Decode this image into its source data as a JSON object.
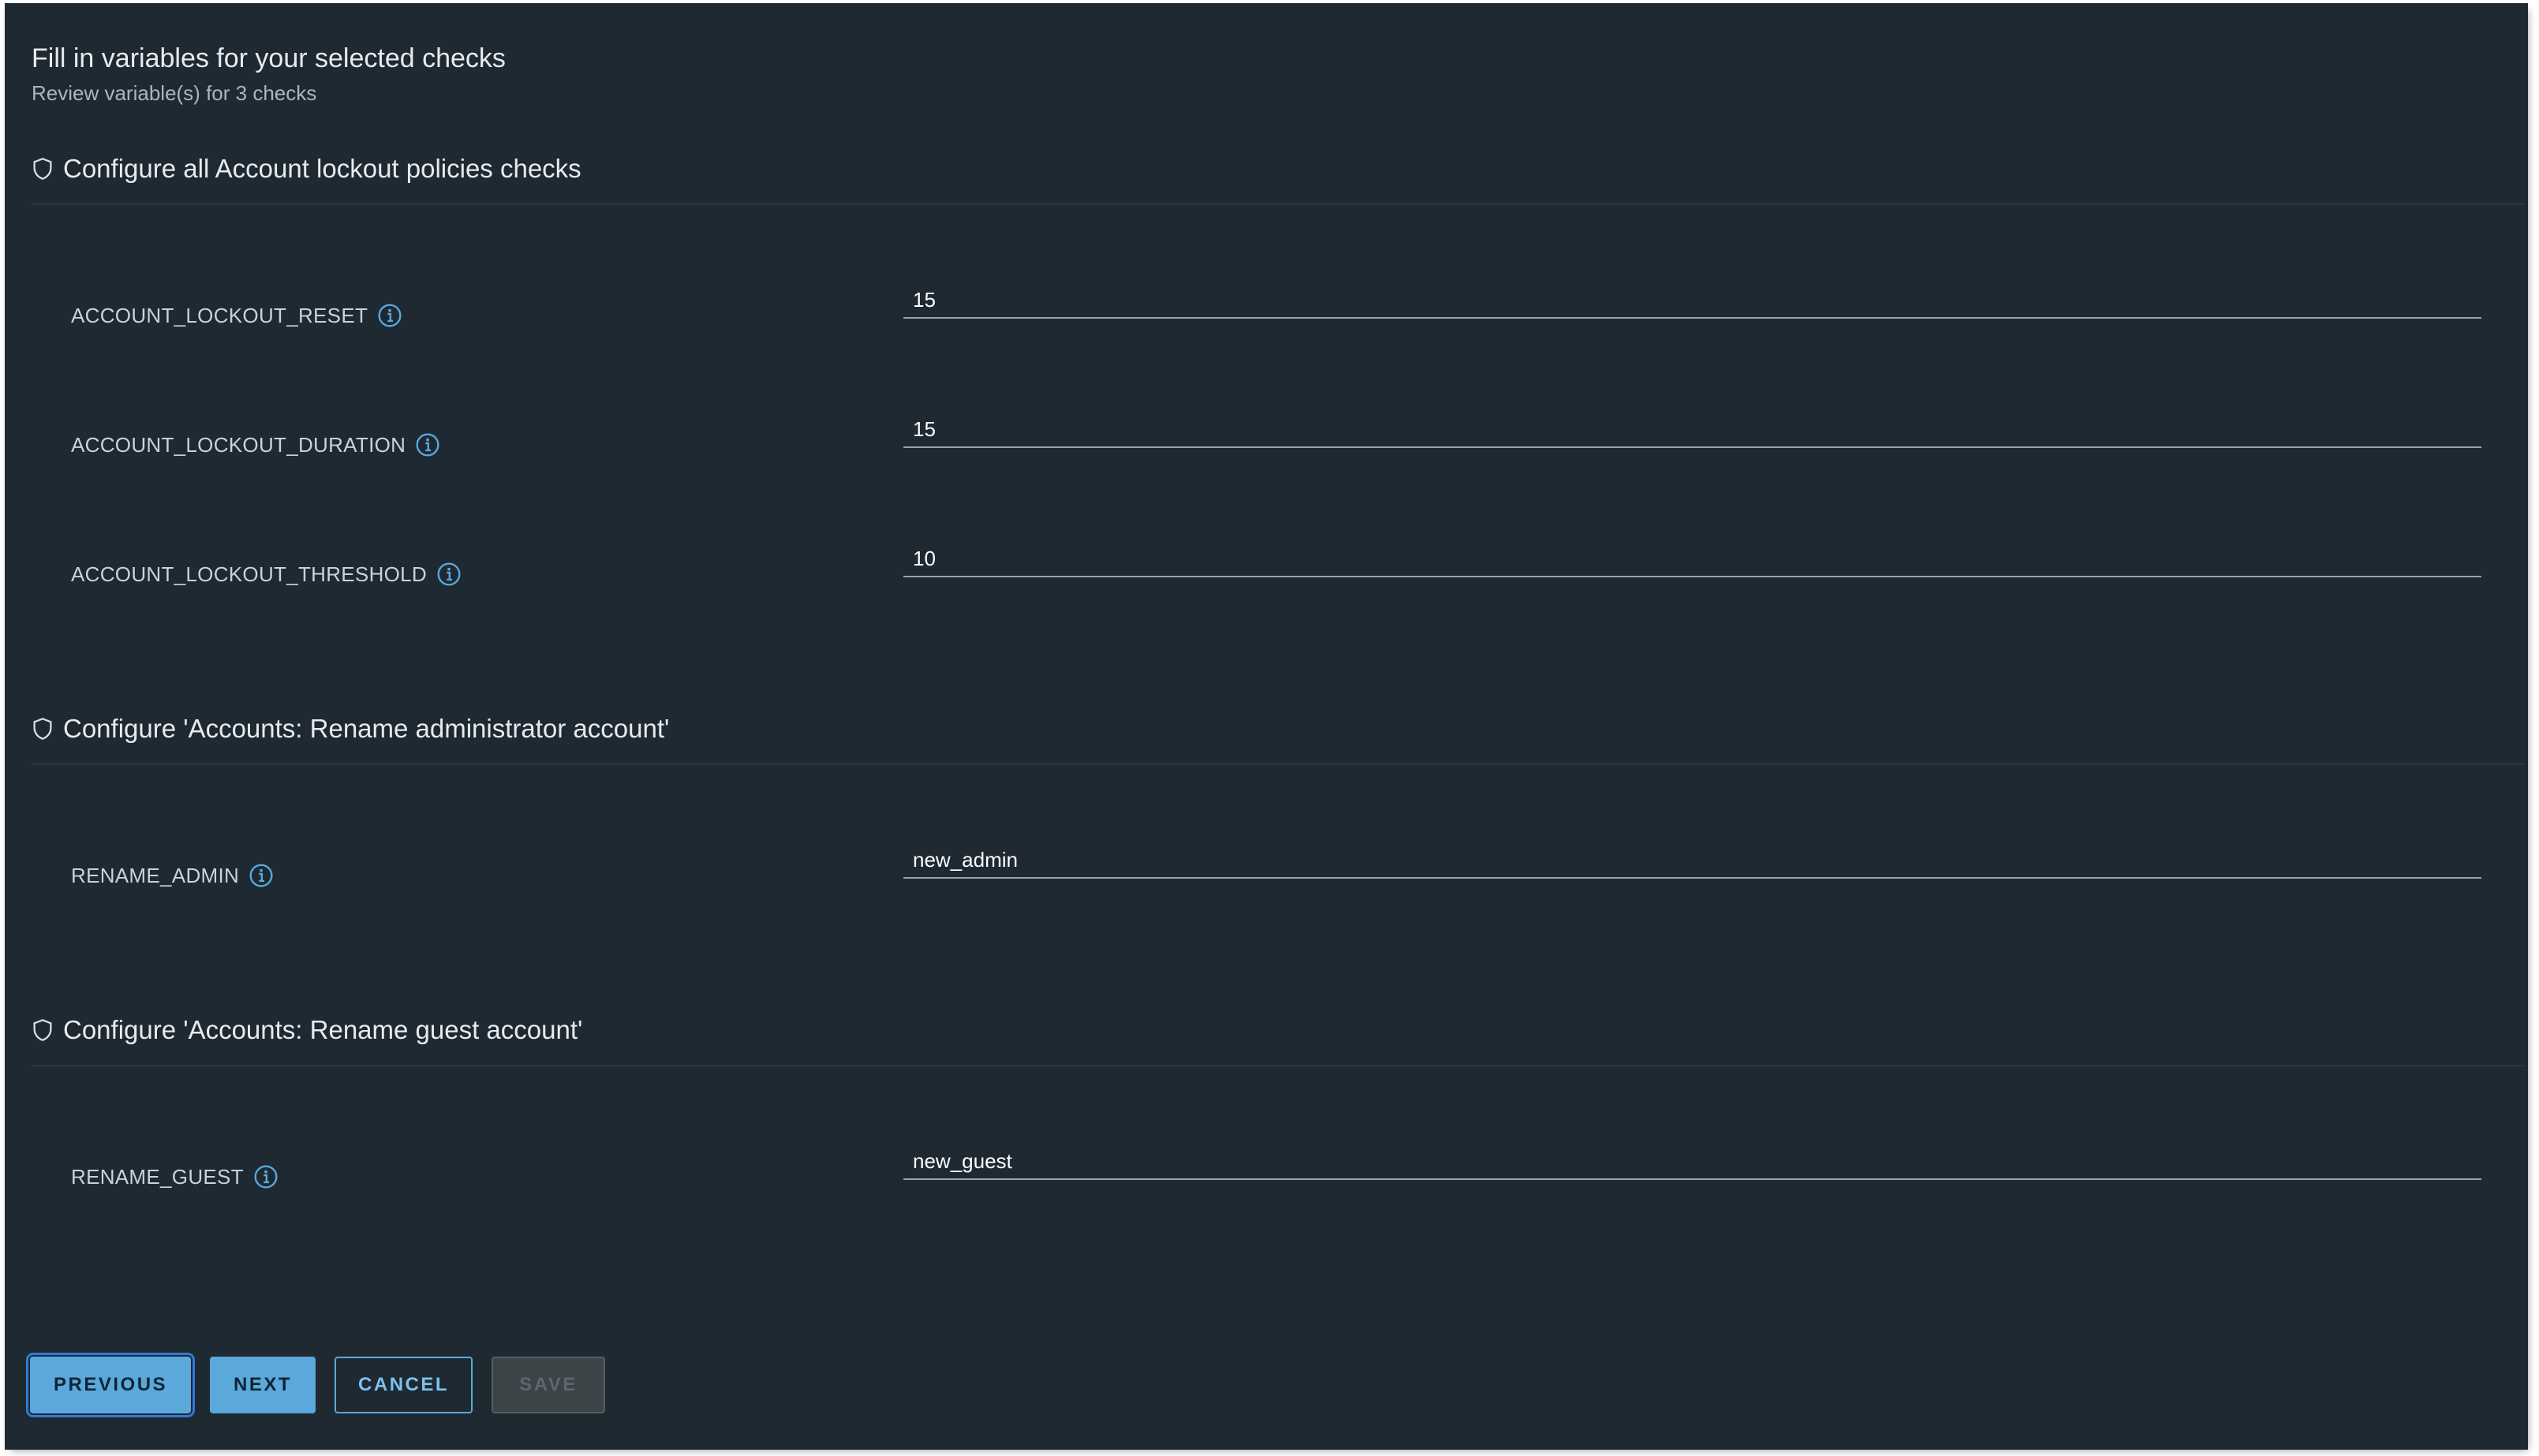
{
  "header": {
    "title": "Fill in variables for your selected checks",
    "subtitle": "Review variable(s) for 3 checks"
  },
  "sections": [
    {
      "title": "Configure all Account lockout policies checks",
      "icon": "shield-icon",
      "variables": [
        {
          "name": "ACCOUNT_LOCKOUT_RESET",
          "value": "15"
        },
        {
          "name": "ACCOUNT_LOCKOUT_DURATION",
          "value": "15"
        },
        {
          "name": "ACCOUNT_LOCKOUT_THRESHOLD",
          "value": "10"
        }
      ]
    },
    {
      "title": "Configure 'Accounts: Rename administrator account'",
      "icon": "shield-icon",
      "variables": [
        {
          "name": "RENAME_ADMIN",
          "value": "new_admin"
        }
      ]
    },
    {
      "title": "Configure 'Accounts: Rename guest account'",
      "icon": "shield-icon",
      "variables": [
        {
          "name": "RENAME_GUEST",
          "value": "new_guest"
        }
      ]
    }
  ],
  "footer": {
    "previous_label": "PREVIOUS",
    "next_label": "NEXT",
    "cancel_label": "CANCEL",
    "save_label": "SAVE"
  },
  "colors": {
    "background": "#1e2932",
    "accent": "#5ba8dc",
    "field_underline": "#9aa6ae"
  }
}
